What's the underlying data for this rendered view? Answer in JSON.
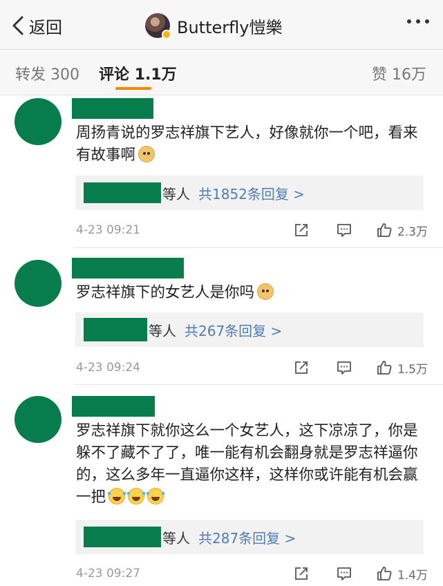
{
  "header": {
    "back_label": "返回",
    "title": "Butterfly愷樂"
  },
  "tabs": {
    "forward_label": "转发",
    "forward_count": "300",
    "comment_label": "评论",
    "comment_count": "1.1万",
    "like_label": "赞",
    "like_count": "16万"
  },
  "comments": [
    {
      "text": "周扬青说的罗志祥旗下艺人，好像就你一个吧，看来有故事啊",
      "emoji": [
        "doge-emoji"
      ],
      "reply_suffix": "等人",
      "reply_count": "共1852条回复 >",
      "time": "4-23 09:21",
      "likes": "2.3万"
    },
    {
      "text": "罗志祥旗下的女艺人是你吗",
      "emoji": [
        "doge-emoji"
      ],
      "reply_suffix": "等人",
      "reply_count": "共267条回复 >",
      "time": "4-23 09:24",
      "likes": "1.5万"
    },
    {
      "text": "罗志祥旗下就你这么一个女艺人，这下凉凉了，你是躲不了藏不了了，唯一能有机会翻身就是罗志祥逼你的，这么多年一直逼你这样，这样你或许能有机会赢一把",
      "emoji": [
        "laugh-cry-emoji",
        "laugh-cry-emoji",
        "laugh-cry-emoji"
      ],
      "reply_suffix": "等人",
      "reply_count": "共287条回复 >",
      "time": "4-23 09:27",
      "likes": "1.4万"
    }
  ],
  "colors": {
    "redaction_green": "#077c4c",
    "accent_orange": "#ff8200",
    "link_blue": "#4f7db3"
  },
  "icons": {
    "back": "chevron-left-icon",
    "more": "more-dots-icon",
    "share": "share-icon",
    "reply": "comment-icon",
    "like": "thumbs-up-icon"
  }
}
